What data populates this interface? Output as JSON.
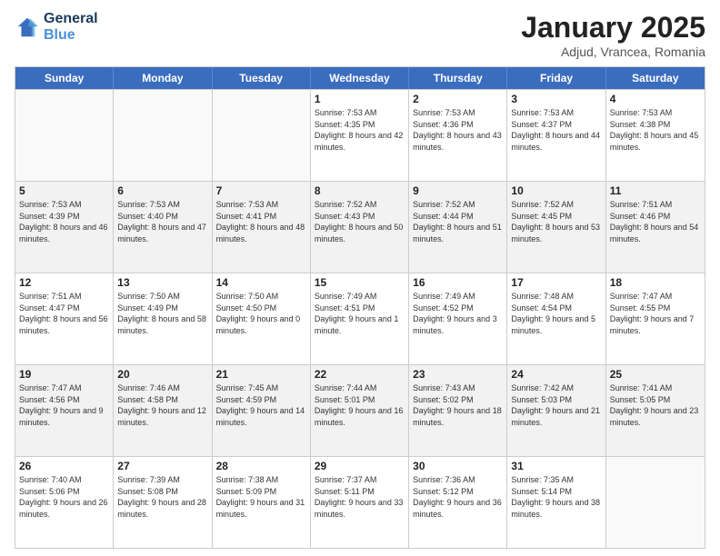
{
  "logo": {
    "line1": "General",
    "line2": "Blue"
  },
  "title": "January 2025",
  "location": "Adjud, Vrancea, Romania",
  "days": [
    "Sunday",
    "Monday",
    "Tuesday",
    "Wednesday",
    "Thursday",
    "Friday",
    "Saturday"
  ],
  "weeks": [
    [
      {
        "day": "",
        "info": ""
      },
      {
        "day": "",
        "info": ""
      },
      {
        "day": "",
        "info": ""
      },
      {
        "day": "1",
        "info": "Sunrise: 7:53 AM\nSunset: 4:35 PM\nDaylight: 8 hours\nand 42 minutes."
      },
      {
        "day": "2",
        "info": "Sunrise: 7:53 AM\nSunset: 4:36 PM\nDaylight: 8 hours\nand 43 minutes."
      },
      {
        "day": "3",
        "info": "Sunrise: 7:53 AM\nSunset: 4:37 PM\nDaylight: 8 hours\nand 44 minutes."
      },
      {
        "day": "4",
        "info": "Sunrise: 7:53 AM\nSunset: 4:38 PM\nDaylight: 8 hours\nand 45 minutes."
      }
    ],
    [
      {
        "day": "5",
        "info": "Sunrise: 7:53 AM\nSunset: 4:39 PM\nDaylight: 8 hours\nand 46 minutes."
      },
      {
        "day": "6",
        "info": "Sunrise: 7:53 AM\nSunset: 4:40 PM\nDaylight: 8 hours\nand 47 minutes."
      },
      {
        "day": "7",
        "info": "Sunrise: 7:53 AM\nSunset: 4:41 PM\nDaylight: 8 hours\nand 48 minutes."
      },
      {
        "day": "8",
        "info": "Sunrise: 7:52 AM\nSunset: 4:43 PM\nDaylight: 8 hours\nand 50 minutes."
      },
      {
        "day": "9",
        "info": "Sunrise: 7:52 AM\nSunset: 4:44 PM\nDaylight: 8 hours\nand 51 minutes."
      },
      {
        "day": "10",
        "info": "Sunrise: 7:52 AM\nSunset: 4:45 PM\nDaylight: 8 hours\nand 53 minutes."
      },
      {
        "day": "11",
        "info": "Sunrise: 7:51 AM\nSunset: 4:46 PM\nDaylight: 8 hours\nand 54 minutes."
      }
    ],
    [
      {
        "day": "12",
        "info": "Sunrise: 7:51 AM\nSunset: 4:47 PM\nDaylight: 8 hours\nand 56 minutes."
      },
      {
        "day": "13",
        "info": "Sunrise: 7:50 AM\nSunset: 4:49 PM\nDaylight: 8 hours\nand 58 minutes."
      },
      {
        "day": "14",
        "info": "Sunrise: 7:50 AM\nSunset: 4:50 PM\nDaylight: 9 hours\nand 0 minutes."
      },
      {
        "day": "15",
        "info": "Sunrise: 7:49 AM\nSunset: 4:51 PM\nDaylight: 9 hours\nand 1 minute."
      },
      {
        "day": "16",
        "info": "Sunrise: 7:49 AM\nSunset: 4:52 PM\nDaylight: 9 hours\nand 3 minutes."
      },
      {
        "day": "17",
        "info": "Sunrise: 7:48 AM\nSunset: 4:54 PM\nDaylight: 9 hours\nand 5 minutes."
      },
      {
        "day": "18",
        "info": "Sunrise: 7:47 AM\nSunset: 4:55 PM\nDaylight: 9 hours\nand 7 minutes."
      }
    ],
    [
      {
        "day": "19",
        "info": "Sunrise: 7:47 AM\nSunset: 4:56 PM\nDaylight: 9 hours\nand 9 minutes."
      },
      {
        "day": "20",
        "info": "Sunrise: 7:46 AM\nSunset: 4:58 PM\nDaylight: 9 hours\nand 12 minutes."
      },
      {
        "day": "21",
        "info": "Sunrise: 7:45 AM\nSunset: 4:59 PM\nDaylight: 9 hours\nand 14 minutes."
      },
      {
        "day": "22",
        "info": "Sunrise: 7:44 AM\nSunset: 5:01 PM\nDaylight: 9 hours\nand 16 minutes."
      },
      {
        "day": "23",
        "info": "Sunrise: 7:43 AM\nSunset: 5:02 PM\nDaylight: 9 hours\nand 18 minutes."
      },
      {
        "day": "24",
        "info": "Sunrise: 7:42 AM\nSunset: 5:03 PM\nDaylight: 9 hours\nand 21 minutes."
      },
      {
        "day": "25",
        "info": "Sunrise: 7:41 AM\nSunset: 5:05 PM\nDaylight: 9 hours\nand 23 minutes."
      }
    ],
    [
      {
        "day": "26",
        "info": "Sunrise: 7:40 AM\nSunset: 5:06 PM\nDaylight: 9 hours\nand 26 minutes."
      },
      {
        "day": "27",
        "info": "Sunrise: 7:39 AM\nSunset: 5:08 PM\nDaylight: 9 hours\nand 28 minutes."
      },
      {
        "day": "28",
        "info": "Sunrise: 7:38 AM\nSunset: 5:09 PM\nDaylight: 9 hours\nand 31 minutes."
      },
      {
        "day": "29",
        "info": "Sunrise: 7:37 AM\nSunset: 5:11 PM\nDaylight: 9 hours\nand 33 minutes."
      },
      {
        "day": "30",
        "info": "Sunrise: 7:36 AM\nSunset: 5:12 PM\nDaylight: 9 hours\nand 36 minutes."
      },
      {
        "day": "31",
        "info": "Sunrise: 7:35 AM\nSunset: 5:14 PM\nDaylight: 9 hours\nand 38 minutes."
      },
      {
        "day": "",
        "info": ""
      }
    ]
  ]
}
